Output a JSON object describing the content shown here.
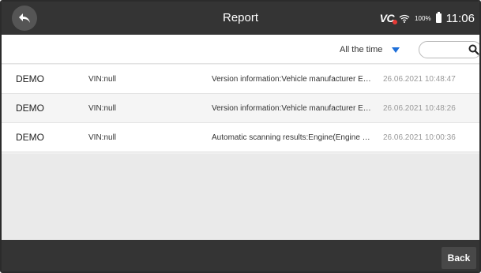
{
  "header": {
    "title": "Report",
    "vci_label": "VC",
    "battery_percent": "100%",
    "time": "11:06",
    "icons": [
      "back-arrow-icon",
      "wifi-icon",
      "battery-icon"
    ]
  },
  "filter": {
    "time_range": "All the time",
    "search_placeholder": ""
  },
  "reports": [
    {
      "name": "DEMO",
      "vin": "VIN:null",
      "description": "Version information:Vehicle manufacturer EC…",
      "date": "26.06.2021 10:48:47"
    },
    {
      "name": "DEMO",
      "vin": "VIN:null",
      "description": "Version information:Vehicle manufacturer EC…",
      "date": "26.06.2021 10:48:26"
    },
    {
      "name": "DEMO",
      "vin": "VIN:null",
      "description": "Automatic scanning results:Engine(Engine con…",
      "date": "26.06.2021 10:00:36"
    }
  ],
  "footer": {
    "back_label": "Back"
  },
  "colors": {
    "bar_background": "#343434",
    "accent": "#1e6fd9",
    "vci_dot": "#e53935"
  }
}
